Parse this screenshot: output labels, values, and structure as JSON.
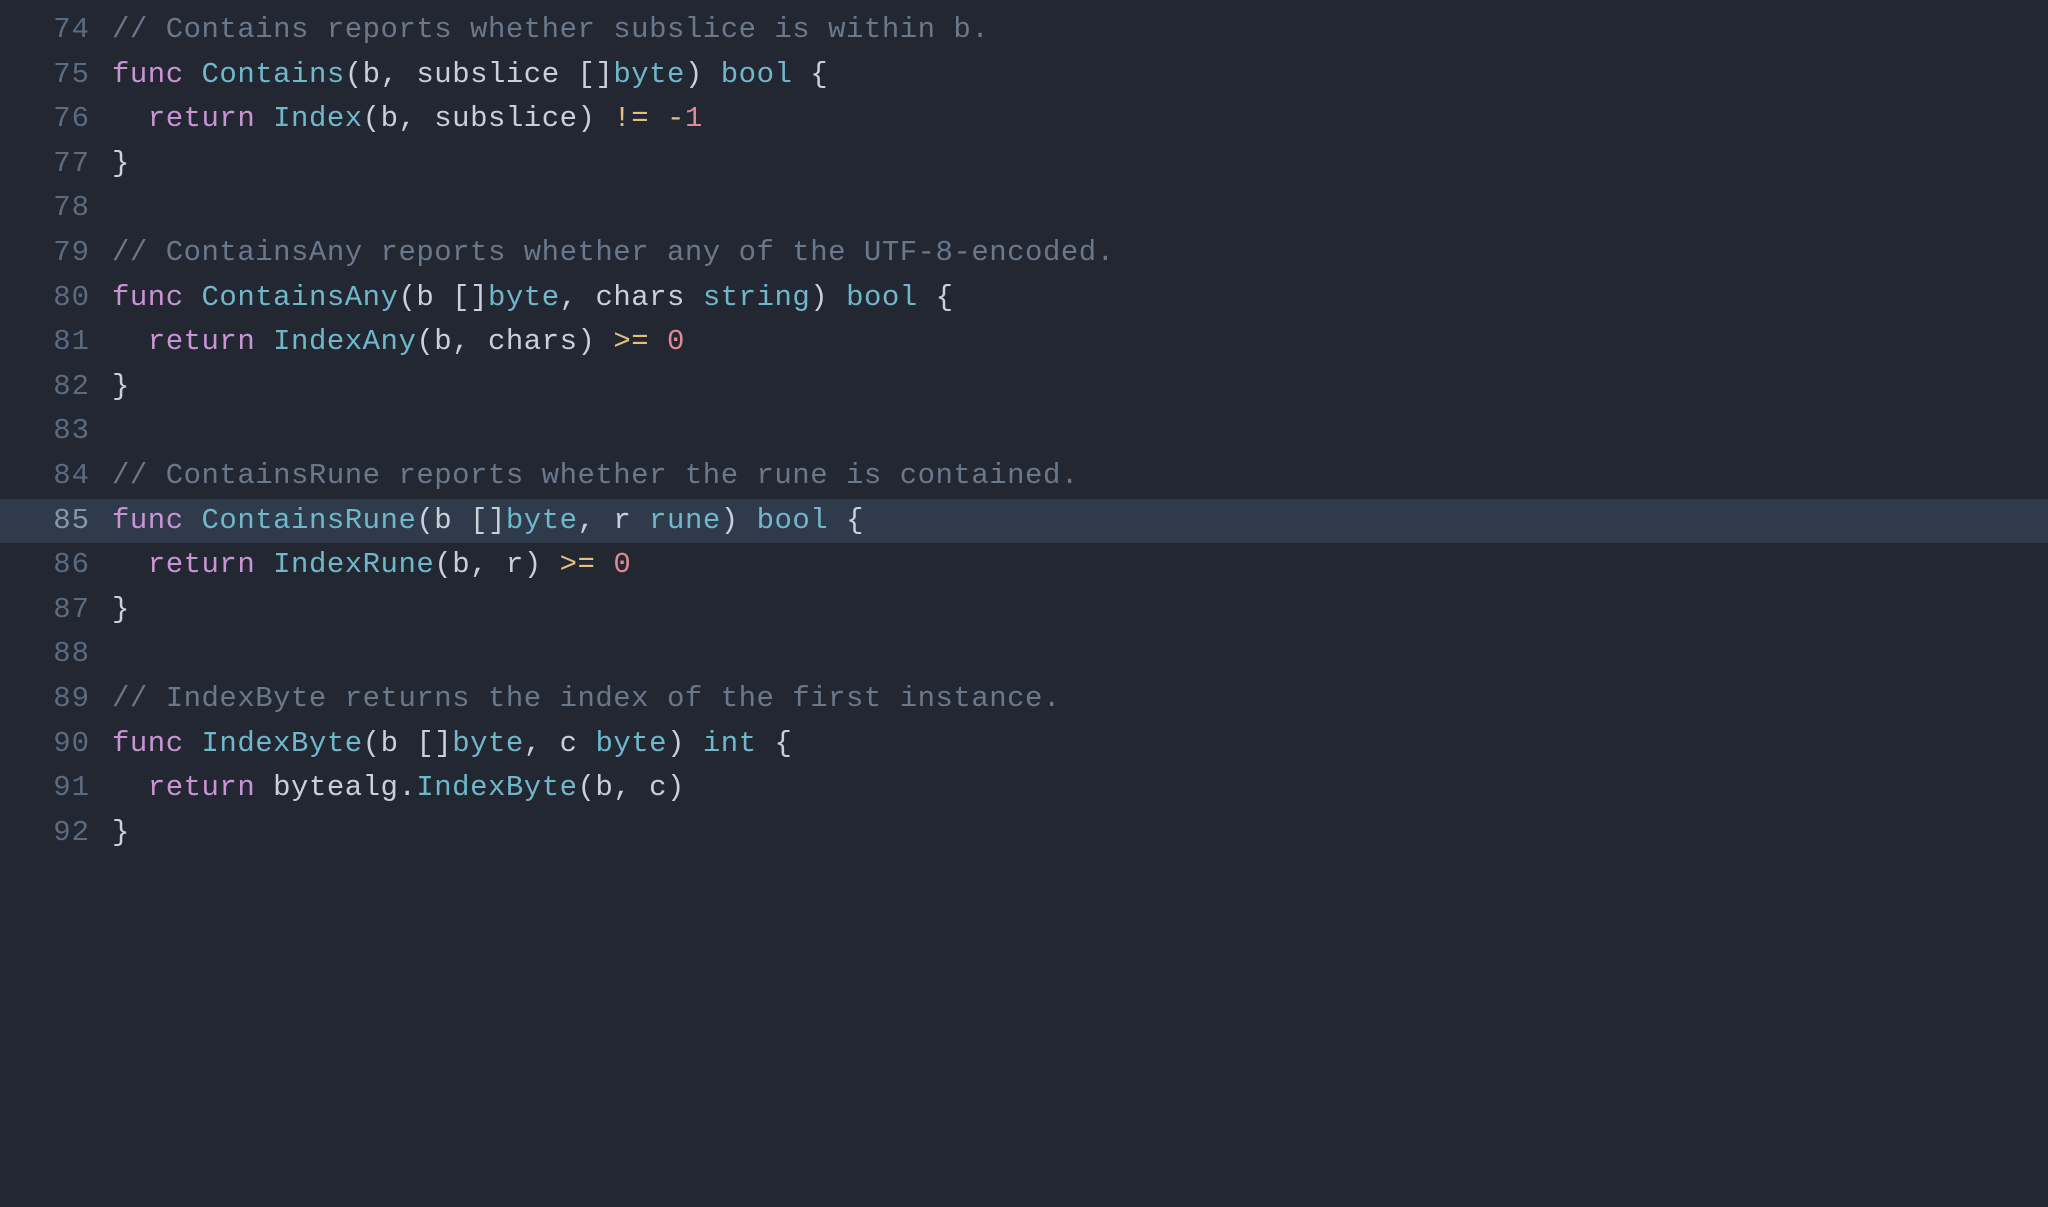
{
  "editor": {
    "startLine": 74,
    "highlightedLine": 85,
    "lines": [
      {
        "n": 74,
        "tokens": [
          {
            "cls": "cm",
            "t": "// Contains reports whether subslice is within b."
          }
        ]
      },
      {
        "n": 75,
        "tokens": [
          {
            "cls": "kw",
            "t": "func"
          },
          {
            "cls": "pn",
            "t": " "
          },
          {
            "cls": "fn",
            "t": "Contains"
          },
          {
            "cls": "pn",
            "t": "("
          },
          {
            "cls": "id",
            "t": "b"
          },
          {
            "cls": "pn",
            "t": ", "
          },
          {
            "cls": "id",
            "t": "subslice"
          },
          {
            "cls": "pn",
            "t": " []"
          },
          {
            "cls": "typ",
            "t": "byte"
          },
          {
            "cls": "pn",
            "t": ") "
          },
          {
            "cls": "typ",
            "t": "bool"
          },
          {
            "cls": "pn",
            "t": " {"
          }
        ]
      },
      {
        "n": 76,
        "tokens": [
          {
            "cls": "pn",
            "t": "  "
          },
          {
            "cls": "kw",
            "t": "return"
          },
          {
            "cls": "pn",
            "t": " "
          },
          {
            "cls": "fn",
            "t": "Index"
          },
          {
            "cls": "pn",
            "t": "("
          },
          {
            "cls": "id",
            "t": "b"
          },
          {
            "cls": "pn",
            "t": ", "
          },
          {
            "cls": "id",
            "t": "subslice"
          },
          {
            "cls": "pn",
            "t": ") "
          },
          {
            "cls": "op",
            "t": "!="
          },
          {
            "cls": "pn",
            "t": " "
          },
          {
            "cls": "op",
            "t": "-"
          },
          {
            "cls": "num",
            "t": "1"
          }
        ]
      },
      {
        "n": 77,
        "tokens": [
          {
            "cls": "pn",
            "t": "}"
          }
        ]
      },
      {
        "n": 78,
        "tokens": [
          {
            "cls": "pn",
            "t": ""
          }
        ]
      },
      {
        "n": 79,
        "tokens": [
          {
            "cls": "cm",
            "t": "// ContainsAny reports whether any of the UTF-8-encoded."
          }
        ]
      },
      {
        "n": 80,
        "tokens": [
          {
            "cls": "kw",
            "t": "func"
          },
          {
            "cls": "pn",
            "t": " "
          },
          {
            "cls": "fn",
            "t": "ContainsAny"
          },
          {
            "cls": "pn",
            "t": "("
          },
          {
            "cls": "id",
            "t": "b"
          },
          {
            "cls": "pn",
            "t": " []"
          },
          {
            "cls": "typ",
            "t": "byte"
          },
          {
            "cls": "pn",
            "t": ", "
          },
          {
            "cls": "id",
            "t": "chars"
          },
          {
            "cls": "pn",
            "t": " "
          },
          {
            "cls": "typ",
            "t": "string"
          },
          {
            "cls": "pn",
            "t": ") "
          },
          {
            "cls": "typ",
            "t": "bool"
          },
          {
            "cls": "pn",
            "t": " {"
          }
        ]
      },
      {
        "n": 81,
        "tokens": [
          {
            "cls": "pn",
            "t": "  "
          },
          {
            "cls": "kw",
            "t": "return"
          },
          {
            "cls": "pn",
            "t": " "
          },
          {
            "cls": "fn",
            "t": "IndexAny"
          },
          {
            "cls": "pn",
            "t": "("
          },
          {
            "cls": "id",
            "t": "b"
          },
          {
            "cls": "pn",
            "t": ", "
          },
          {
            "cls": "id",
            "t": "chars"
          },
          {
            "cls": "pn",
            "t": ") "
          },
          {
            "cls": "op",
            "t": ">="
          },
          {
            "cls": "pn",
            "t": " "
          },
          {
            "cls": "num",
            "t": "0"
          }
        ]
      },
      {
        "n": 82,
        "tokens": [
          {
            "cls": "pn",
            "t": "}"
          }
        ]
      },
      {
        "n": 83,
        "tokens": [
          {
            "cls": "pn",
            "t": ""
          }
        ]
      },
      {
        "n": 84,
        "tokens": [
          {
            "cls": "cm",
            "t": "// ContainsRune reports whether the rune is contained."
          }
        ]
      },
      {
        "n": 85,
        "tokens": [
          {
            "cls": "kw",
            "t": "func"
          },
          {
            "cls": "pn",
            "t": " "
          },
          {
            "cls": "fn",
            "t": "ContainsRune"
          },
          {
            "cls": "pn",
            "t": "("
          },
          {
            "cls": "id",
            "t": "b"
          },
          {
            "cls": "pn",
            "t": " []"
          },
          {
            "cls": "typ",
            "t": "byte"
          },
          {
            "cls": "pn",
            "t": ", "
          },
          {
            "cls": "id",
            "t": "r"
          },
          {
            "cls": "pn",
            "t": " "
          },
          {
            "cls": "typ",
            "t": "rune"
          },
          {
            "cls": "pn",
            "t": ") "
          },
          {
            "cls": "typ",
            "t": "bool"
          },
          {
            "cls": "pn",
            "t": " {"
          }
        ]
      },
      {
        "n": 86,
        "tokens": [
          {
            "cls": "pn",
            "t": "  "
          },
          {
            "cls": "kw",
            "t": "return"
          },
          {
            "cls": "pn",
            "t": " "
          },
          {
            "cls": "fn",
            "t": "IndexRune"
          },
          {
            "cls": "pn",
            "t": "("
          },
          {
            "cls": "id",
            "t": "b"
          },
          {
            "cls": "pn",
            "t": ", "
          },
          {
            "cls": "id",
            "t": "r"
          },
          {
            "cls": "pn",
            "t": ") "
          },
          {
            "cls": "op",
            "t": ">="
          },
          {
            "cls": "pn",
            "t": " "
          },
          {
            "cls": "num",
            "t": "0"
          }
        ]
      },
      {
        "n": 87,
        "tokens": [
          {
            "cls": "pn",
            "t": "}"
          }
        ]
      },
      {
        "n": 88,
        "tokens": [
          {
            "cls": "pn",
            "t": ""
          }
        ]
      },
      {
        "n": 89,
        "tokens": [
          {
            "cls": "cm",
            "t": "// IndexByte returns the index of the first instance."
          }
        ]
      },
      {
        "n": 90,
        "tokens": [
          {
            "cls": "kw",
            "t": "func"
          },
          {
            "cls": "pn",
            "t": " "
          },
          {
            "cls": "fn",
            "t": "IndexByte"
          },
          {
            "cls": "pn",
            "t": "("
          },
          {
            "cls": "id",
            "t": "b"
          },
          {
            "cls": "pn",
            "t": " []"
          },
          {
            "cls": "typ",
            "t": "byte"
          },
          {
            "cls": "pn",
            "t": ", "
          },
          {
            "cls": "id",
            "t": "c"
          },
          {
            "cls": "pn",
            "t": " "
          },
          {
            "cls": "typ",
            "t": "byte"
          },
          {
            "cls": "pn",
            "t": ") "
          },
          {
            "cls": "typ",
            "t": "int"
          },
          {
            "cls": "pn",
            "t": " {"
          }
        ]
      },
      {
        "n": 91,
        "tokens": [
          {
            "cls": "pn",
            "t": "  "
          },
          {
            "cls": "kw",
            "t": "return"
          },
          {
            "cls": "pn",
            "t": " "
          },
          {
            "cls": "id",
            "t": "bytealg"
          },
          {
            "cls": "pn",
            "t": "."
          },
          {
            "cls": "fn",
            "t": "IndexByte"
          },
          {
            "cls": "pn",
            "t": "("
          },
          {
            "cls": "id",
            "t": "b"
          },
          {
            "cls": "pn",
            "t": ", "
          },
          {
            "cls": "id",
            "t": "c"
          },
          {
            "cls": "pn",
            "t": ")"
          }
        ]
      },
      {
        "n": 92,
        "tokens": [
          {
            "cls": "pn",
            "t": "}"
          }
        ]
      }
    ]
  }
}
